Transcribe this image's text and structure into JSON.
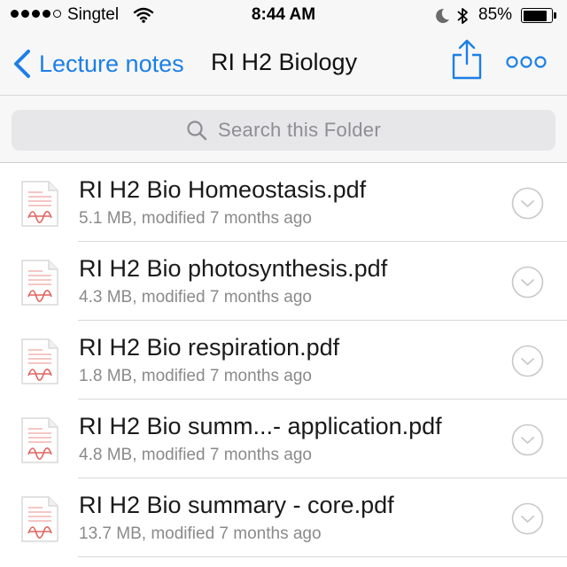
{
  "status_bar": {
    "carrier": "Singtel",
    "time": "8:44 AM",
    "battery_percent": "85%",
    "battery_level": 0.85,
    "signal_bars_filled": 4,
    "signal_bars_total": 5,
    "icons": [
      "signal-dots-icon",
      "wifi-icon",
      "moon-icon",
      "bluetooth-icon",
      "battery-icon"
    ]
  },
  "nav": {
    "back_label": "Lecture notes",
    "title": "RI H2 Biology",
    "icons": [
      "chevron-left-icon",
      "share-icon",
      "more-icon"
    ],
    "accent_color": "#1c7fe6"
  },
  "search": {
    "placeholder": "Search this Folder",
    "icon": "search-icon"
  },
  "files": [
    {
      "name": "RI H2 Bio Homeostasis.pdf",
      "meta": "5.1 MB, modified 7 months ago",
      "icon": "pdf-file-icon"
    },
    {
      "name": "RI H2 Bio photosynthesis.pdf",
      "meta": "4.3 MB, modified 7 months ago",
      "icon": "pdf-file-icon"
    },
    {
      "name": "RI H2 Bio respiration.pdf",
      "meta": "1.8 MB, modified 7 months ago",
      "icon": "pdf-file-icon"
    },
    {
      "name": "RI H2 Bio summ...- application.pdf",
      "meta": "4.8 MB, modified 7 months ago",
      "icon": "pdf-file-icon"
    },
    {
      "name": "RI H2 Bio summary - core.pdf",
      "meta": "13.7 MB, modified 7 months ago",
      "icon": "pdf-file-icon"
    }
  ]
}
